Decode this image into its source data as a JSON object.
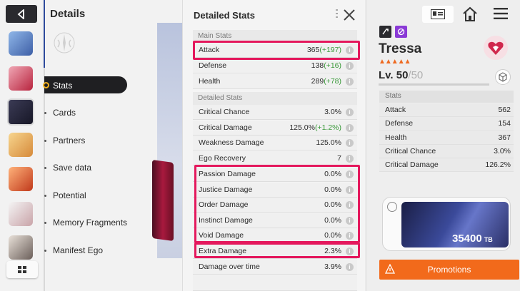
{
  "left": {
    "title": "Details",
    "nav": [
      {
        "label": "Stats"
      },
      {
        "label": "Cards"
      },
      {
        "label": "Partners"
      },
      {
        "label": "Save data"
      },
      {
        "label": "Potential"
      },
      {
        "label": "Memory Fragments"
      },
      {
        "label": "Manifest Ego"
      }
    ]
  },
  "panel": {
    "title": "Detailed Stats",
    "main_label": "Main Stats",
    "detailed_label": "Detailed Stats",
    "main_stats": [
      {
        "name": "Attack",
        "value": "365",
        "bonus": "(+197)"
      },
      {
        "name": "Defense",
        "value": "138",
        "bonus": "(+16)"
      },
      {
        "name": "Health",
        "value": "289",
        "bonus": "(+78)"
      }
    ],
    "detailed_stats": [
      {
        "name": "Critical Chance",
        "value": "3.0%",
        "bonus": ""
      },
      {
        "name": "Critical Damage",
        "value": "125.0%",
        "bonus": "(+1.2%)"
      },
      {
        "name": "Weakness Damage",
        "value": "125.0%",
        "bonus": ""
      },
      {
        "name": "Ego Recovery",
        "value": "7",
        "bonus": ""
      },
      {
        "name": "Passion Damage",
        "value": "0.0%",
        "bonus": ""
      },
      {
        "name": "Justice Damage",
        "value": "0.0%",
        "bonus": ""
      },
      {
        "name": "Order Damage",
        "value": "0.0%",
        "bonus": ""
      },
      {
        "name": "Instinct Damage",
        "value": "0.0%",
        "bonus": ""
      },
      {
        "name": "Void Damage",
        "value": "0.0%",
        "bonus": ""
      },
      {
        "name": "Extra Damage",
        "value": "2.3%",
        "bonus": ""
      },
      {
        "name": "Damage over time",
        "value": "3.9%",
        "bonus": ""
      }
    ]
  },
  "right": {
    "name": "Tressa",
    "rarity": "▲▲▲▲▲",
    "level_label": "Lv. ",
    "level": "50",
    "level_sep": "/",
    "level_max": "50",
    "stats_header": "Stats",
    "stats": [
      {
        "name": "Attack",
        "value": "562"
      },
      {
        "name": "Defense",
        "value": "154"
      },
      {
        "name": "Health",
        "value": "367"
      },
      {
        "name": "Critical Chance",
        "value": "3.0%"
      },
      {
        "name": "Critical Damage",
        "value": "126.2%"
      }
    ],
    "weapon_value": "35400",
    "weapon_unit": "TB",
    "promotions_label": "Promotions"
  },
  "colors": {
    "highlight": "#e4185d",
    "bonus": "#3a9a3a",
    "promo": "#f26a1b",
    "nav_active_dot": "#f2b01e"
  }
}
